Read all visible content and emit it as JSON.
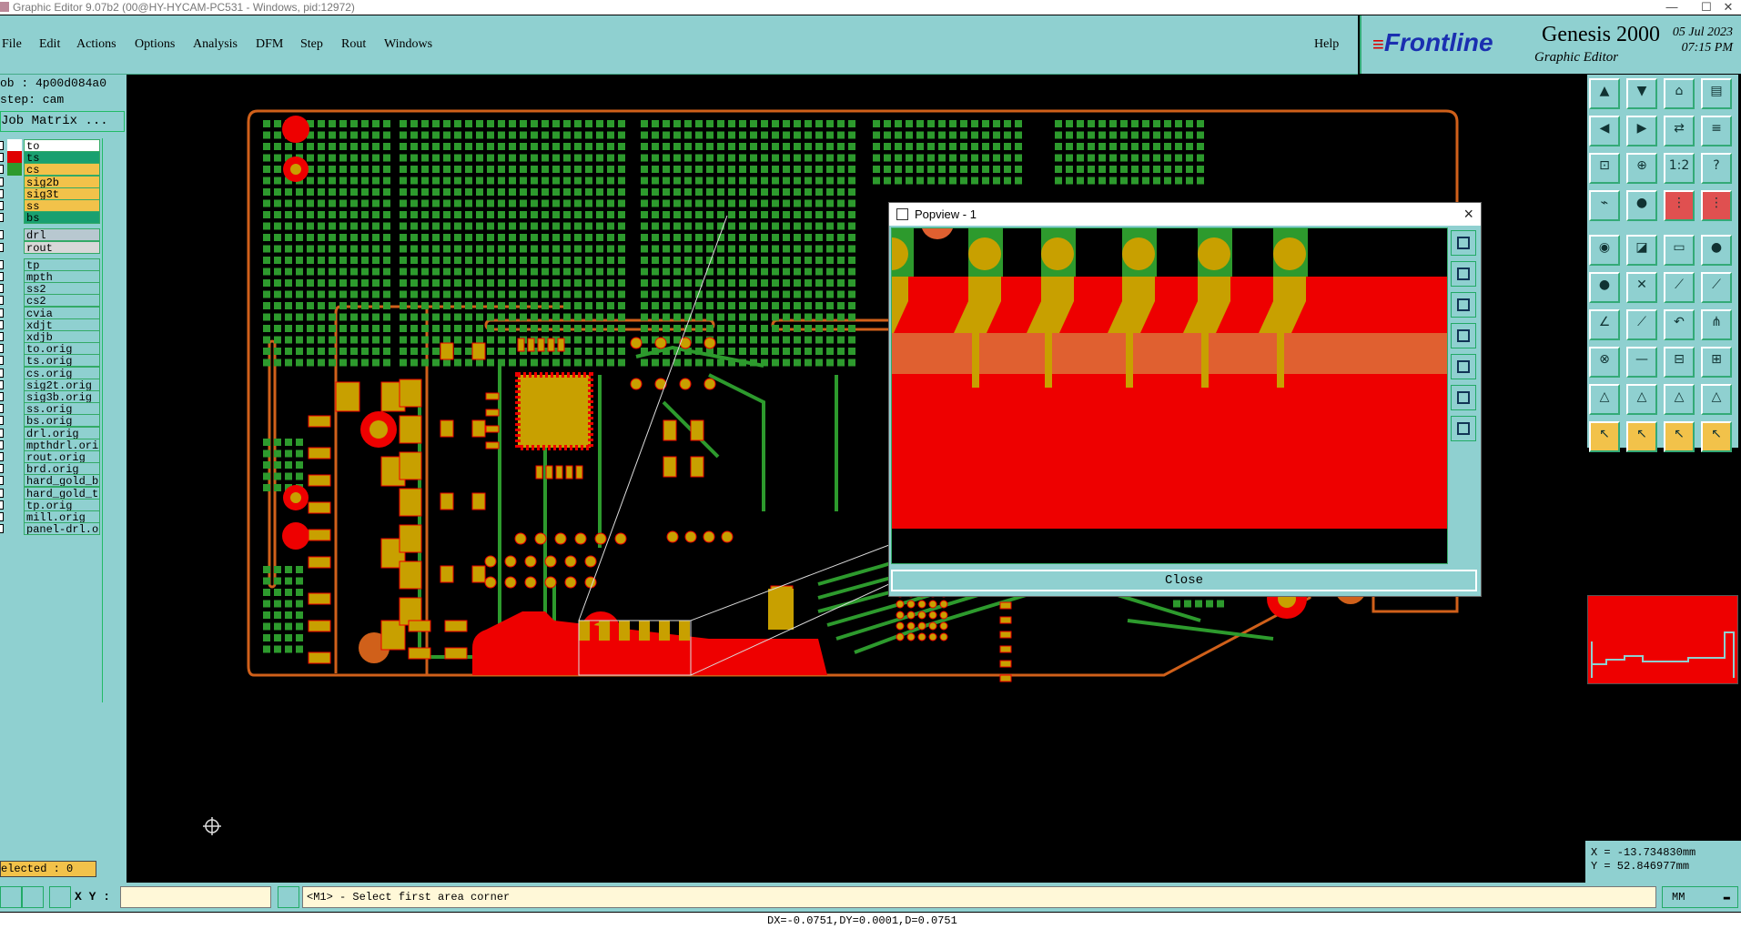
{
  "window": {
    "title": "Graphic Editor 9.07b2 (00@HY-HYCAM-PC531 - Windows, pid:12972)",
    "controls": [
      "—",
      "☐",
      "✕"
    ]
  },
  "menu": {
    "items": [
      "File",
      "Edit",
      "Actions",
      "Options",
      "Analysis",
      "DFM",
      "Step",
      "Rout",
      "Windows"
    ],
    "help": "Help"
  },
  "brand": {
    "logo": "Frontline",
    "product": "Genesis 2000",
    "subtitle": "Graphic Editor",
    "date": "05 Jul 2023",
    "time": "07:15 PM"
  },
  "job": {
    "job_label": "ob : 4p00d084a0",
    "step_label": "step: cam",
    "job_matrix": "Job Matrix ..."
  },
  "layers": [
    {
      "name": "to",
      "color": "#ffffff",
      "bg": "#ffffff"
    },
    {
      "name": "ts",
      "color": "#e00000",
      "bg": "#19a070"
    },
    {
      "name": "cs",
      "color": "#2d9a2d",
      "bg": "#f2c24a"
    },
    {
      "name": "sig2b",
      "color": "",
      "bg": "#f2c24a"
    },
    {
      "name": "sig3t",
      "color": "",
      "bg": "#f2c24a"
    },
    {
      "name": "ss",
      "color": "",
      "bg": "#f2c24a"
    },
    {
      "name": "bs",
      "color": "",
      "bg": "#19a070"
    },
    {
      "name": "drl",
      "color": "",
      "bg": "#b8c8d0"
    },
    {
      "name": "rout",
      "color": "",
      "bg": "#d8d8d8"
    },
    {
      "name": "tp",
      "color": "",
      "bg": "#8fd0d0"
    },
    {
      "name": "mpth",
      "color": "",
      "bg": "#8fd0d0"
    },
    {
      "name": "ss2",
      "color": "",
      "bg": "#8fd0d0"
    },
    {
      "name": "cs2",
      "color": "",
      "bg": "#8fd0d0"
    },
    {
      "name": "cvia",
      "color": "",
      "bg": "#8fd0d0"
    },
    {
      "name": "xdjt",
      "color": "",
      "bg": "#8fd0d0"
    },
    {
      "name": "xdjb",
      "color": "",
      "bg": "#8fd0d0"
    },
    {
      "name": "to.orig",
      "color": "",
      "bg": "#8fd0d0"
    },
    {
      "name": "ts.orig",
      "color": "",
      "bg": "#8fd0d0"
    },
    {
      "name": "cs.orig",
      "color": "",
      "bg": "#8fd0d0"
    },
    {
      "name": "sig2t.orig",
      "color": "",
      "bg": "#8fd0d0"
    },
    {
      "name": "sig3b.orig",
      "color": "",
      "bg": "#8fd0d0"
    },
    {
      "name": "ss.orig",
      "color": "",
      "bg": "#8fd0d0"
    },
    {
      "name": "bs.orig",
      "color": "",
      "bg": "#8fd0d0"
    },
    {
      "name": "drl.orig",
      "color": "",
      "bg": "#8fd0d0"
    },
    {
      "name": "mpthdrl.orig",
      "color": "",
      "bg": "#8fd0d0"
    },
    {
      "name": "rout.orig",
      "color": "",
      "bg": "#8fd0d0"
    },
    {
      "name": "brd.orig",
      "color": "",
      "bg": "#8fd0d0"
    },
    {
      "name": "hard_gold_b",
      "color": "",
      "bg": "#8fd0d0"
    },
    {
      "name": "hard_gold_t",
      "color": "",
      "bg": "#8fd0d0"
    },
    {
      "name": "tp.orig",
      "color": "",
      "bg": "#8fd0d0"
    },
    {
      "name": "mill.orig",
      "color": "",
      "bg": "#8fd0d0"
    },
    {
      "name": "panel-drl.or",
      "color": "",
      "bg": "#8fd0d0"
    }
  ],
  "selected": "elected : 0",
  "popview": {
    "title": "Popview - 1",
    "close_label": "Close"
  },
  "coords": {
    "x": "X = -13.734830mm",
    "y": "Y = 52.846977mm"
  },
  "bottom": {
    "xy_label": "X Y :",
    "xy_value": "",
    "prompt": "<M1> - Select first area corner",
    "unit": "MM"
  },
  "status": "DX=-0.0751,DY=0.0001,D=0.0751",
  "colors": {
    "panel": "#8fd0d0",
    "copper_green": "#2d9a2d",
    "pad_gold": "#c8a000",
    "mask_red": "#e00000",
    "outline_orange": "#d0601a"
  }
}
